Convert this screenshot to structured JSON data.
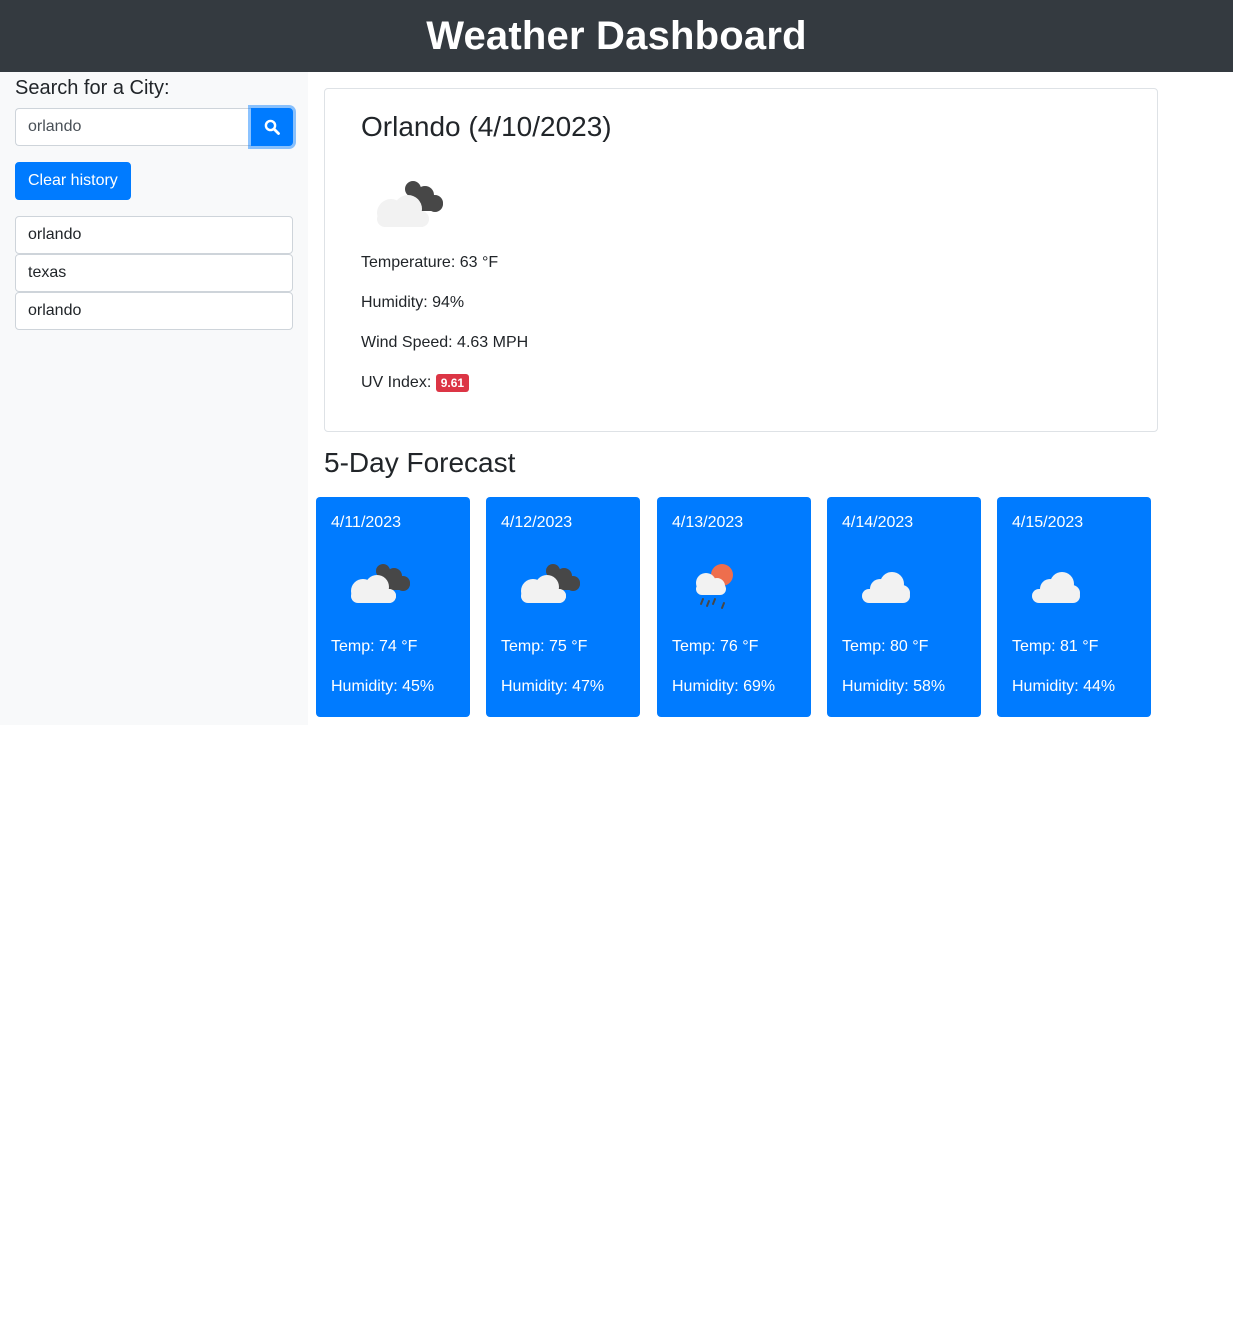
{
  "header": {
    "title": "Weather Dashboard"
  },
  "sidebar": {
    "search_label": "Search for a City:",
    "search_value": "orlando",
    "search_icon": "search-icon",
    "clear_label": "Clear history",
    "history": [
      "orlando",
      "texas",
      "orlando"
    ]
  },
  "current": {
    "title": "Orlando (4/10/2023)",
    "icon": "broken-clouds-icon",
    "temperature": "Temperature: 63 °F",
    "humidity": "Humidity: 94%",
    "wind": "Wind Speed: 4.63 MPH",
    "uv_label": "UV Index:",
    "uv_value": "9.61"
  },
  "forecast": {
    "title": "5-Day Forecast",
    "days": [
      {
        "date": "4/11/2023",
        "icon": "broken-clouds-icon",
        "temp": "Temp: 74 °F",
        "humidity": "Humidity: 45%"
      },
      {
        "date": "4/12/2023",
        "icon": "broken-clouds-icon",
        "temp": "Temp: 75 °F",
        "humidity": "Humidity: 47%"
      },
      {
        "date": "4/13/2023",
        "icon": "rain-sun-icon",
        "temp": "Temp: 76 °F",
        "humidity": "Humidity: 69%"
      },
      {
        "date": "4/14/2023",
        "icon": "cloud-icon",
        "temp": "Temp: 80 °F",
        "humidity": "Humidity: 58%"
      },
      {
        "date": "4/15/2023",
        "icon": "cloud-icon",
        "temp": "Temp: 81 °F",
        "humidity": "Humidity: 44%"
      }
    ]
  },
  "colors": {
    "header_bg": "#343a40",
    "primary": "#007bff",
    "danger": "#dc3545",
    "sidebar_bg": "#f8f9fa"
  }
}
